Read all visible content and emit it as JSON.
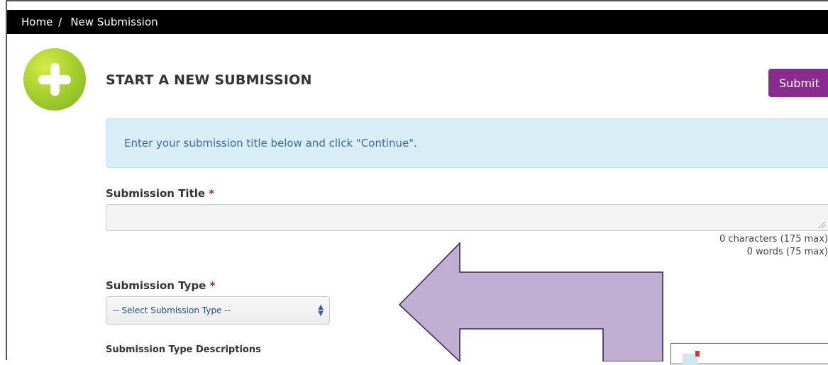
{
  "breadcrumb": {
    "home": "Home",
    "separator": "/",
    "current": "New Submission"
  },
  "header": {
    "title": "START A NEW SUBMISSION",
    "submit_label": "Submit"
  },
  "info": {
    "message": "Enter your submission title below and click \"Continue\"."
  },
  "form": {
    "title_label": "Submission Title",
    "title_value": "",
    "required_mark": "*",
    "char_counter": "0 characters (175 max)",
    "word_counter": "0 words (75 max)",
    "type_label": "Submission Type",
    "type_selected": "-- Select Submission Type --",
    "type_desc_label": "Submission Type Descriptions"
  },
  "icons": {
    "add": "plus-circle-icon",
    "select_arrows": "updown-arrows-icon",
    "annotation_arrow": "arrow-icon"
  },
  "colors": {
    "accent": "#8b2b92",
    "info_bg": "#d9edf7",
    "info_text": "#31708f",
    "plus_green": "#a9d12e",
    "arrow_fill": "#c0afd2",
    "required": "#d21c1c"
  }
}
